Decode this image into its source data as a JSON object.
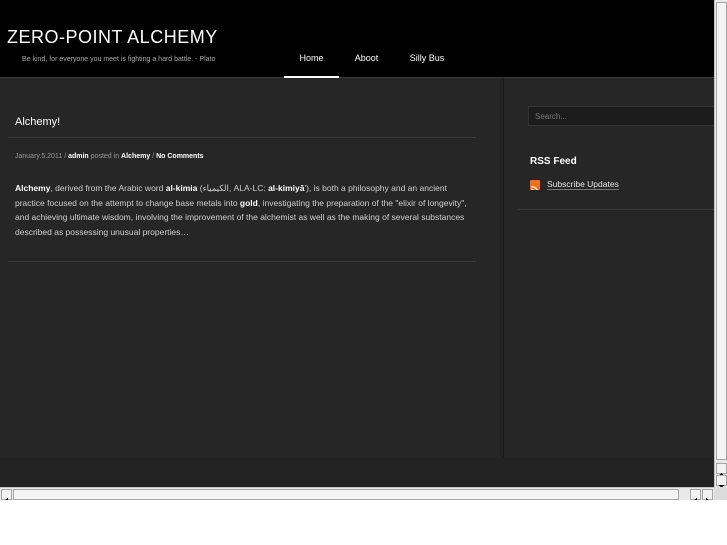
{
  "site": {
    "title": "ZERO-POINT ALCHEMY",
    "tagline": "Be kind, for everyone you meet is fighting a hard battle. - Plato"
  },
  "nav": {
    "items": [
      {
        "label": "Home",
        "active": true
      },
      {
        "label": "Aboot",
        "active": false
      },
      {
        "label": "Silly Bus",
        "active": false
      }
    ]
  },
  "post": {
    "title": "Alchemy!",
    "meta": {
      "date": "January.5.2011",
      "separator": "/",
      "author": "admin",
      "posted_in": "posted in",
      "category": "Alchemy",
      "comments": "No Comments"
    },
    "excerpt": {
      "term": "Alchemy",
      "p1": ", derived from the Arabic word ",
      "arabic_word": "al-kimia",
      "p2": " (الكيمياء, ALA-LC: ",
      "alalc": "al-kimiyā",
      "p3": "'), is both a philosophy and an ancient practice focused on the attempt to change base metals into ",
      "gold": "gold",
      "p4": ", investigating the preparation of the \"elixir of longevity\", and achieving ultimate wisdom, involving the improvement of the alchemist as well as the making of several substances described as possessing unusual properties…"
    }
  },
  "sidebar": {
    "search_placeholder": "Search...",
    "rss_heading": "RSS Feed",
    "rss_link": "Subscribe Updates"
  },
  "colors": {
    "header_bg": "#000000",
    "page_bg": "#232323",
    "rss_orange": "#f26f1f"
  }
}
